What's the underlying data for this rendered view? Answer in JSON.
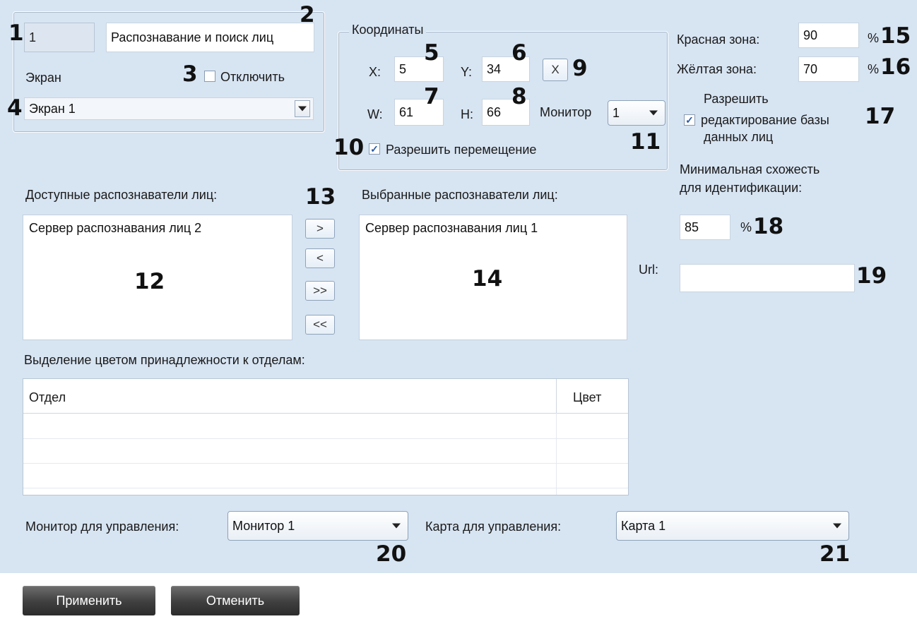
{
  "screen_group": {
    "id_value": "1",
    "name_value": "Распознавание и поиск лиц",
    "screen_label": "Экран",
    "disable_label": "Отключить",
    "disable_checked": false,
    "screen_select_value": "Экран 1"
  },
  "coords": {
    "group_label": "Координаты",
    "x_label": "X:",
    "x_value": "5",
    "y_label": "Y:",
    "y_value": "34",
    "w_label": "W:",
    "w_value": "61",
    "h_label": "H:",
    "h_value": "66",
    "x_button": "X",
    "monitor_label": "Монитор",
    "monitor_value": "1",
    "allow_move_label": "Разрешить перемещение",
    "allow_move_checked": true
  },
  "zones": {
    "red_label": "Красная зона:",
    "red_value": "90",
    "yellow_label": "Жёлтая зона:",
    "yellow_value": "70",
    "percent": "%"
  },
  "edit_db": {
    "line1": "Разрешить",
    "line2": "редактирование базы",
    "line3": "данных лиц",
    "checked": true
  },
  "similarity": {
    "line1": "Минимальная схожесть",
    "line2": "для идентификации:",
    "value": "85",
    "percent": "%"
  },
  "url": {
    "label": "Url:",
    "value": ""
  },
  "recognizers": {
    "available_label": "Доступные распознаватели лиц:",
    "available_items": [
      "Сервер распознавания лиц 2"
    ],
    "selected_label": "Выбранные распознаватели лиц:",
    "selected_items": [
      "Сервер распознавания лиц 1"
    ],
    "buttons": [
      ">",
      "<",
      ">>",
      "<<"
    ]
  },
  "departments": {
    "label": "Выделение цветом принадлежности к отделам:",
    "col_department": "Отдел",
    "col_color": "Цвет"
  },
  "control": {
    "monitor_label": "Монитор для управления:",
    "monitor_value": "Монитор 1",
    "map_label": "Карта для управления:",
    "map_value": "Карта 1"
  },
  "footer": {
    "apply": "Применить",
    "cancel": "Отменить"
  },
  "callouts": [
    "1",
    "2",
    "3",
    "4",
    "5",
    "6",
    "7",
    "8",
    "9",
    "10",
    "11",
    "12",
    "13",
    "14",
    "15",
    "16",
    "17",
    "18",
    "19",
    "20",
    "21"
  ]
}
